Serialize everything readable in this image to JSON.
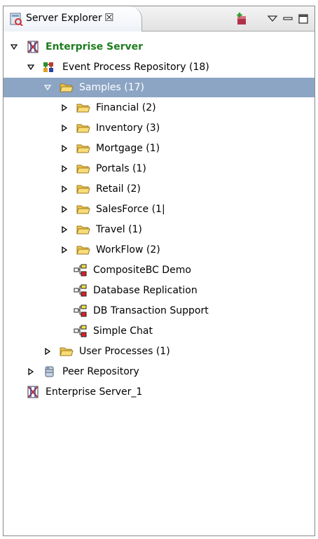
{
  "view": {
    "title": "Server Explorer",
    "close_glyph": "☒",
    "toolbar_icons": [
      "new-server-icon",
      "view-menu-icon",
      "minimize-icon",
      "maximize-icon"
    ]
  },
  "tree": {
    "enterprise_server": "Enterprise Server",
    "event_repo": "Event Process Repository (18)",
    "samples": "Samples (17)",
    "folders": [
      "Financial (2)",
      "Inventory (3)",
      "Mortgage (1)",
      "Portals (1)",
      "Retail (2)",
      "SalesForce (1|",
      "Travel (1)",
      "WorkFlow (2)"
    ],
    "processes": [
      "CompositeBC Demo",
      "Database Replication",
      "DB Transaction Support",
      "Simple Chat"
    ],
    "user_processes": "User Processes (1)",
    "peer_repo": "Peer Repository",
    "enterprise_server_1": "Enterprise Server_1"
  },
  "colors": {
    "selection": "#8ca5c4",
    "server_label": "#1e7d1e",
    "folder": "#f2c44a"
  }
}
